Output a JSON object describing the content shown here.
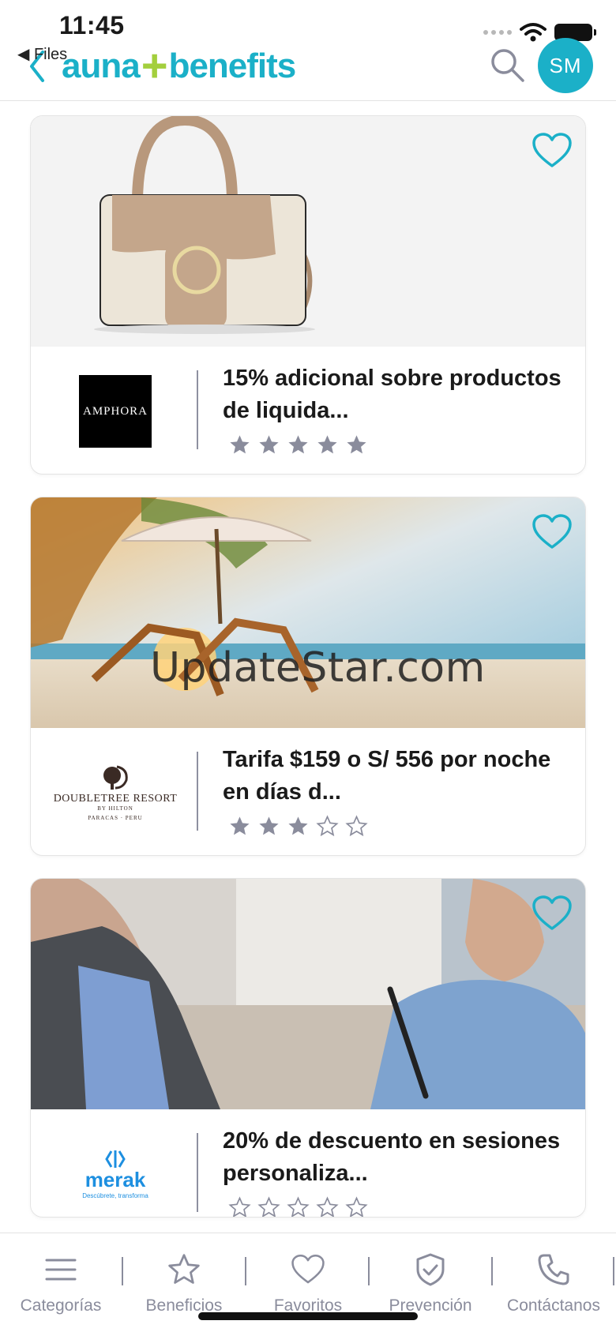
{
  "status_bar": {
    "time": "11:45",
    "back_app": "◀ Files"
  },
  "header": {
    "logo_left": "auna",
    "logo_plus": "+",
    "logo_right": "benefits",
    "avatar_initials": "SM",
    "brand_color": "#1bb0c8",
    "accent_color": "#a3cf3d"
  },
  "offers": [
    {
      "brand": "AMPHORA",
      "title": "15% adicional sobre productos de liquida...",
      "rating": 5,
      "image": "handbag",
      "favorite_icon": "heart-outline-icon"
    },
    {
      "brand": "DOUBLETREE RESORT",
      "brand_sub": "BY HILTON",
      "brand_location": "PARACAS · PERU",
      "title": "Tarifa $159 o S/ 556 por noche en días d...",
      "rating": 3,
      "image": "beach",
      "favorite_icon": "heart-outline-icon"
    },
    {
      "brand": "merak",
      "brand_tagline": "Descúbrete, transforma",
      "title": "20% de descuento en sesiones personaliza...",
      "rating": 0,
      "image": "meeting",
      "favorite_icon": "heart-outline-icon"
    }
  ],
  "watermark": "UpdateStar.com",
  "tabbar": {
    "tabs": [
      {
        "label": "Categorías",
        "icon": "menu-icon"
      },
      {
        "label": "Beneficios",
        "icon": "star-icon"
      },
      {
        "label": "Favoritos",
        "icon": "heart-icon"
      },
      {
        "label": "Prevención",
        "icon": "shield-check-icon"
      },
      {
        "label": "Contáctanos",
        "icon": "phone-icon"
      }
    ]
  }
}
